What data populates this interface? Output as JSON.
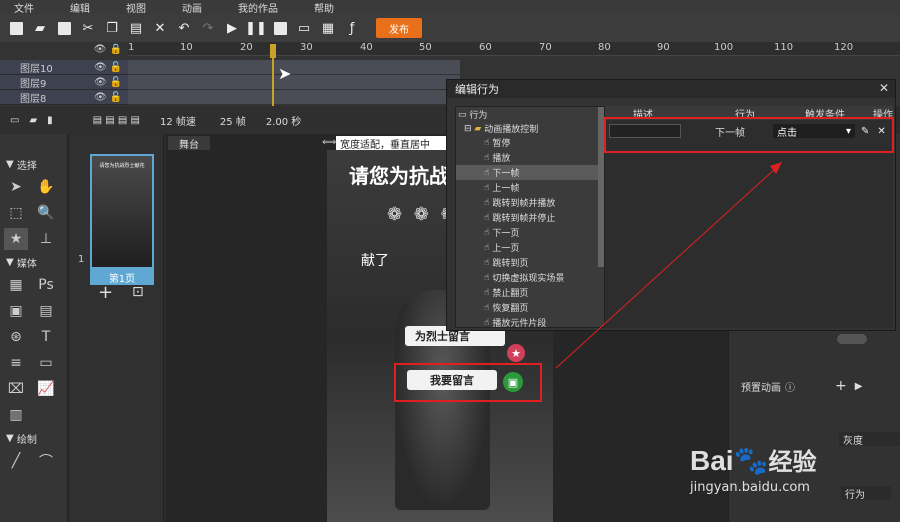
{
  "menu": [
    "文件",
    "编辑",
    "视图",
    "动画",
    "我的作品",
    "帮助"
  ],
  "toolbar": {
    "icons": [
      "new-doc-icon",
      "open-folder-icon",
      "save-icon",
      "cut-icon",
      "copy-icon",
      "paste-icon",
      "delete-icon",
      "undo-icon",
      "redo-icon",
      "play-icon",
      "pause-icon",
      "stop-icon",
      "preview-icon",
      "qrcode-icon",
      "flash-icon"
    ],
    "publish_label": "发布"
  },
  "timeline": {
    "ruler_labels": [
      "1",
      "10",
      "20",
      "30",
      "40",
      "50",
      "60",
      "70",
      "80",
      "90",
      "100",
      "110",
      "120"
    ],
    "layers": [
      {
        "name": "图层10"
      },
      {
        "name": "图层9"
      },
      {
        "name": "图层8"
      }
    ],
    "status": {
      "fps": "12 帧速",
      "frames": "25 帧",
      "duration": "2.00 秒"
    }
  },
  "left_panel": {
    "select_label": "选择",
    "media_label": "媒体",
    "draw_label": "绘制"
  },
  "pages": {
    "page_number": "1",
    "page_label": "第1页",
    "thumb_title": "请您为抗战烈士献花"
  },
  "stage": {
    "tab_label": "舞台",
    "fit_mode": "宽度适配，垂直居中",
    "title_text": "请您为抗战",
    "side_text": "献了",
    "button1_label": "为烈士留言",
    "button2_label": "我要留言"
  },
  "right_panel": {
    "preset_anim_label": "预置动画",
    "gray_label": "灰度",
    "behavior_label": "行为"
  },
  "dialog": {
    "title": "编辑行为",
    "tree_root": "行为",
    "tree_group": "动画播放控制",
    "tree_items": [
      "暂停",
      "播放",
      "下一帧",
      "上一帧",
      "跳转到帧并播放",
      "跳转到帧并停止",
      "下一页",
      "上一页",
      "跳转到页",
      "切换虚拟现实场景",
      "禁止翻页",
      "恢复翻页",
      "播放元件片段"
    ],
    "selected_index": 2,
    "columns": [
      "描述",
      "行为",
      "触发条件",
      "操作"
    ],
    "row": {
      "description": "",
      "behavior": "下一帧",
      "trigger": "点击"
    }
  },
  "watermark": {
    "brand": "Bai",
    "brand2": "经验",
    "url": "jingyan.baidu.com"
  }
}
